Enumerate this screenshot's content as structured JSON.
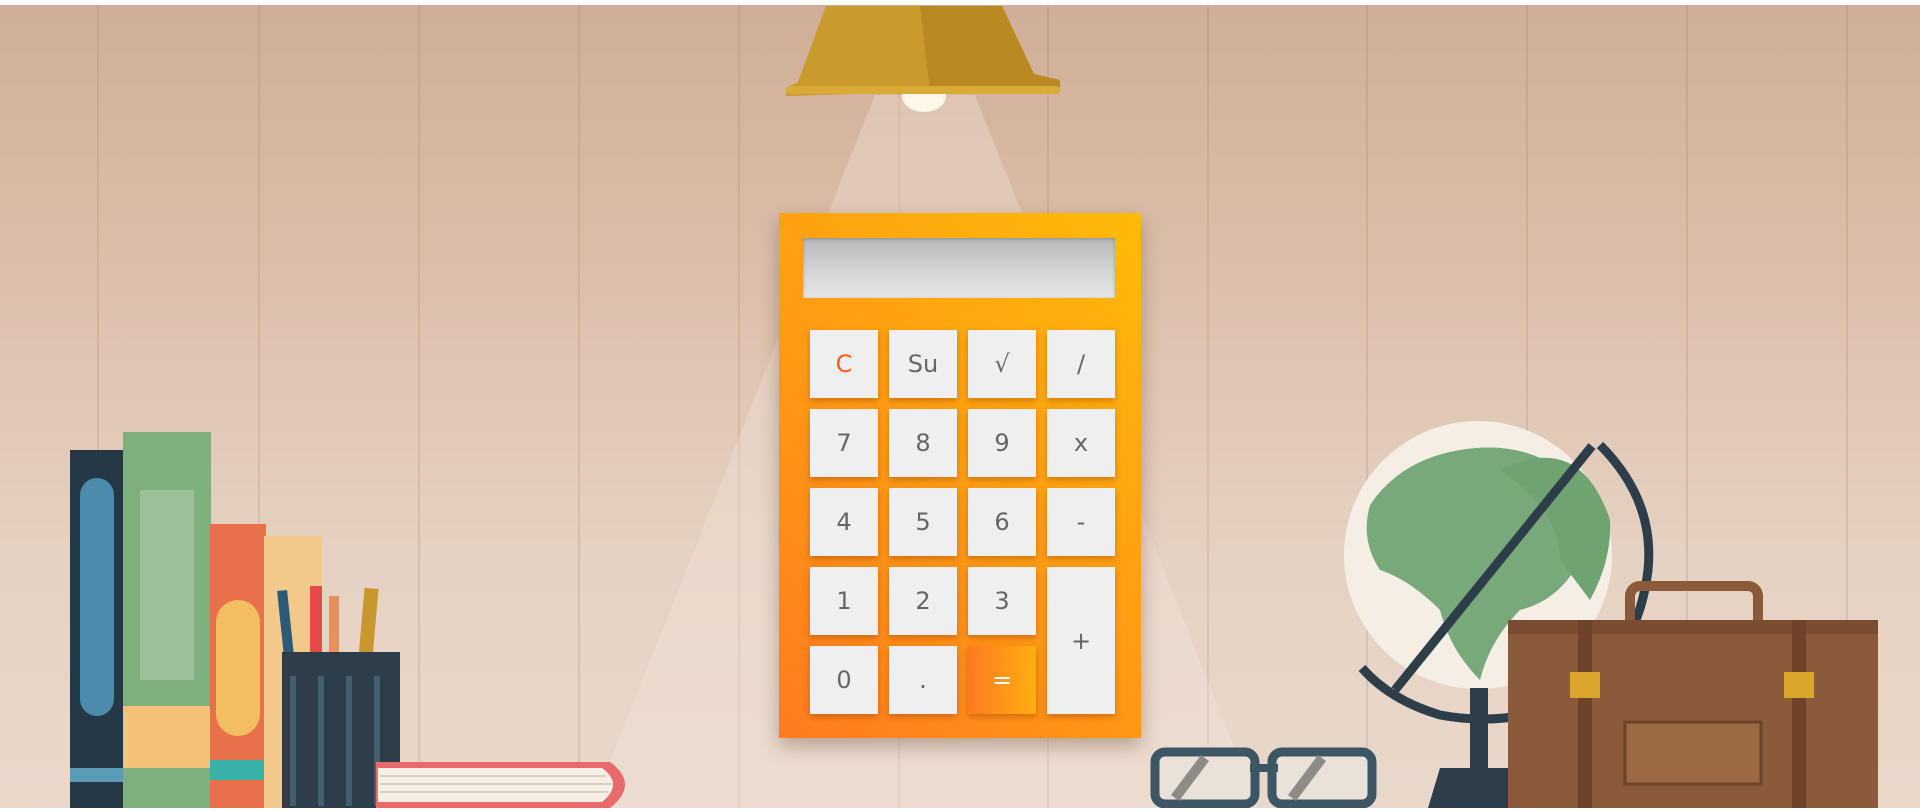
{
  "calculator": {
    "display_value": "",
    "keys": {
      "clear": "C",
      "su": "Su",
      "sqrt": "√",
      "divide": "/",
      "seven": "7",
      "eight": "8",
      "nine": "9",
      "multiply": "x",
      "four": "4",
      "five": "5",
      "six": "6",
      "minus": "-",
      "one": "1",
      "two": "2",
      "three": "3",
      "plus": "+",
      "zero": "0",
      "decimal": ".",
      "equals": "="
    }
  },
  "colors": {
    "calculator_gradient_start": "#ff7a1f",
    "calculator_gradient_end": "#ffba08",
    "key_background": "#efefef",
    "key_text": "#666666",
    "clear_text": "#ff5a1f",
    "wall": "#dcc0ac"
  },
  "icons": {
    "lamp": "ceiling-lamp-icon",
    "books": "book-stack-icon",
    "pencil_cup": "pencil-cup-icon",
    "globe": "globe-icon",
    "glasses": "eyeglasses-icon",
    "briefcase": "briefcase-icon"
  }
}
